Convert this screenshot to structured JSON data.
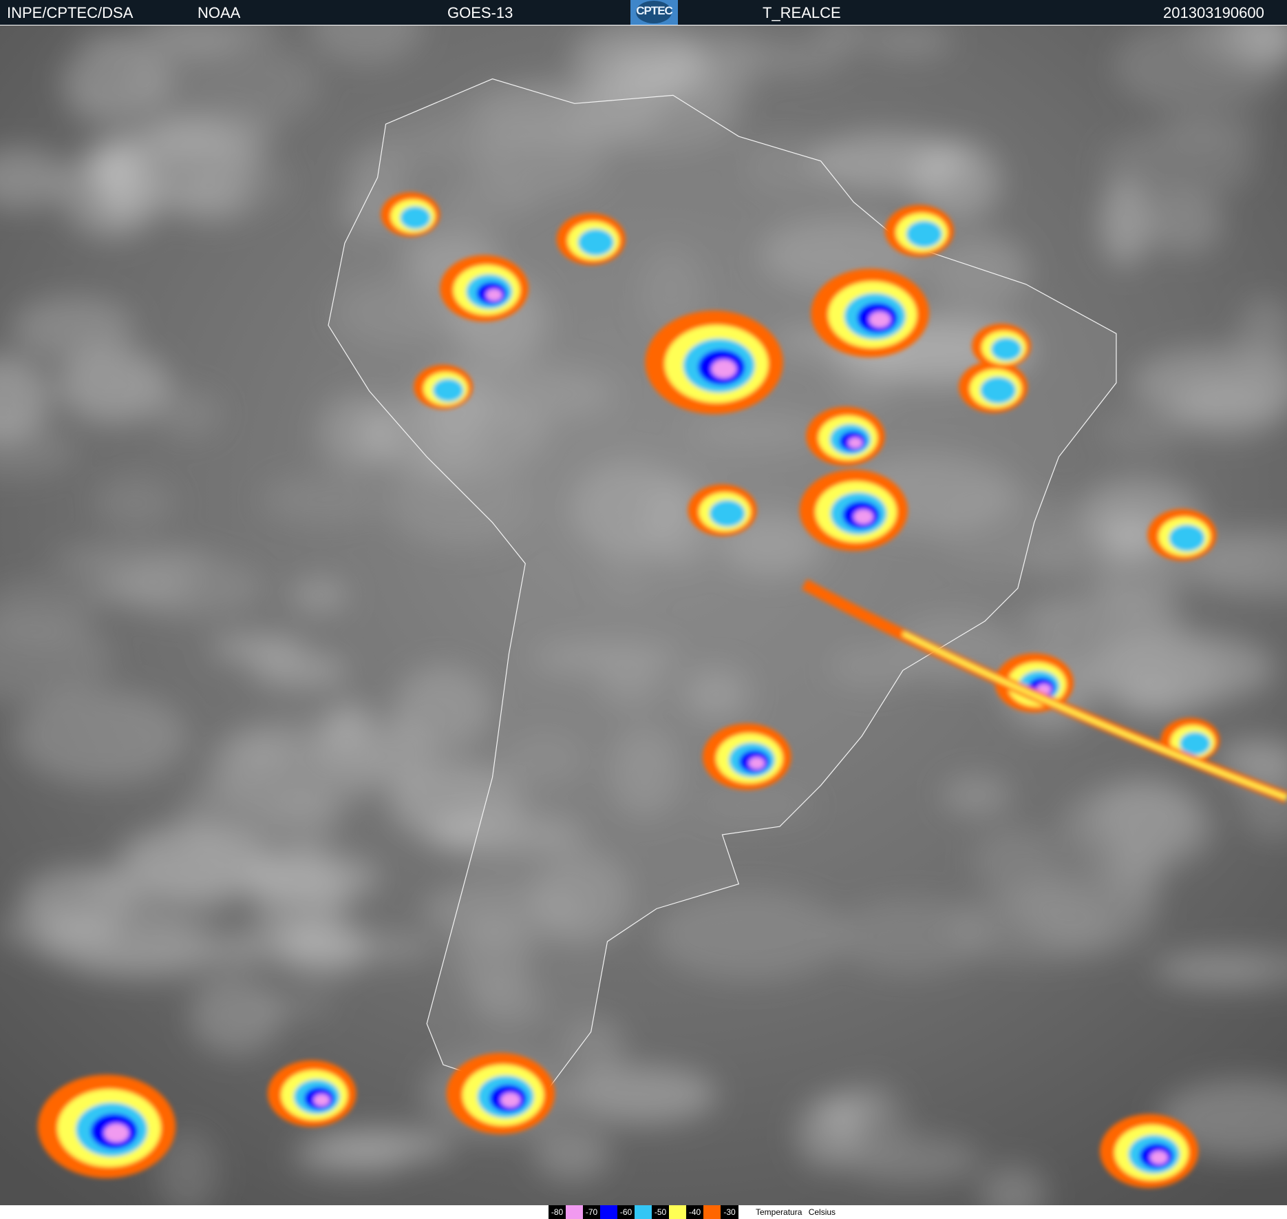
{
  "header": {
    "agency": "INPE/CPTEC/DSA",
    "source": "NOAA",
    "satellite": "GOES-13",
    "logo_text": "CPTEC",
    "product": "T_REALCE",
    "timestamp": "201303190600"
  },
  "legend": {
    "title": "Temperatura   Celsius",
    "steps": [
      {
        "label": "-80",
        "color": "#f19af0"
      },
      {
        "label": "-70",
        "color": "#0000ff"
      },
      {
        "label": "-60",
        "color": "#33c6f5"
      },
      {
        "label": "-50",
        "color": "#ffff55"
      },
      {
        "label": "-40",
        "color": "#ff6600"
      },
      {
        "label": "-30",
        "color": ""
      }
    ]
  }
}
